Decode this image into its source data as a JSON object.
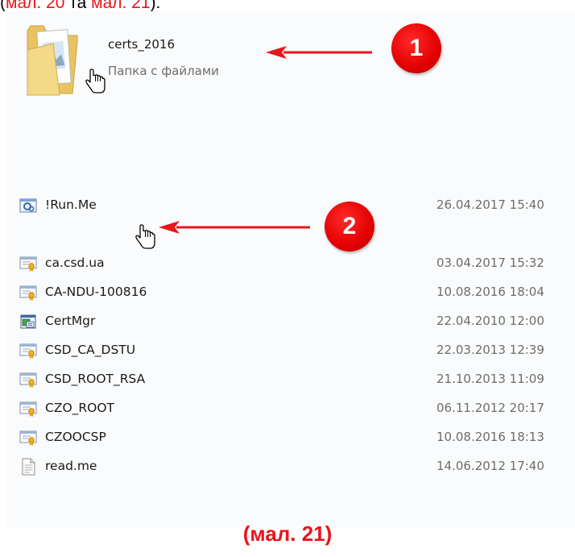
{
  "intro_text": {
    "before": "(",
    "ref1": "мал. 20",
    "middle": " та ",
    "ref2": "мал. 21",
    "after": ")."
  },
  "folder": {
    "name": "certs_2016",
    "type": "Папка с файлами"
  },
  "badges": [
    "1",
    "2"
  ],
  "files": [
    {
      "name": "!Run.Me",
      "date": "26.04.2017 15:40",
      "icon": "run-script-icon"
    },
    {
      "name": "ca.csd.ua",
      "date": "03.04.2017 15:32",
      "icon": "certificate-icon"
    },
    {
      "name": "CA-NDU-100816",
      "date": "10.08.2016 18:04",
      "icon": "certificate-icon"
    },
    {
      "name": "CertMgr",
      "date": "22.04.2010 12:00",
      "icon": "application-icon"
    },
    {
      "name": "CSD_CA_DSTU",
      "date": "22.03.2013 12:39",
      "icon": "certificate-icon"
    },
    {
      "name": "CSD_ROOT_RSA",
      "date": "21.10.2013 11:09",
      "icon": "certificate-icon"
    },
    {
      "name": "CZO_ROOT",
      "date": "06.11.2012 20:17",
      "icon": "certificate-icon"
    },
    {
      "name": "CZOOCSP",
      "date": "10.08.2016 18:13",
      "icon": "certificate-icon"
    },
    {
      "name": "read.me",
      "date": "14.06.2012 17:40",
      "icon": "text-file-icon"
    }
  ],
  "caption": "(мал. 21)",
  "colors": {
    "accent": "#e8151b",
    "badge": "#e30000",
    "folder": "#f3d47d"
  }
}
